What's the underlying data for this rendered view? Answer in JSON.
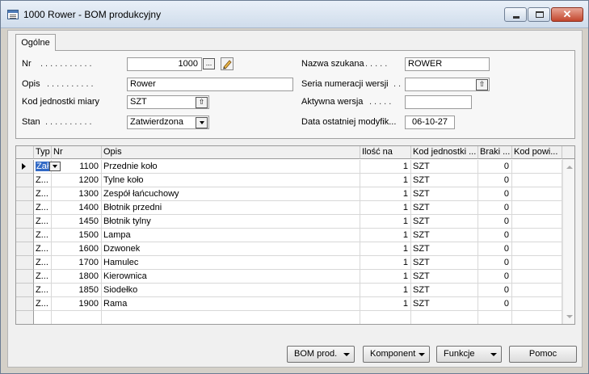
{
  "window": {
    "title": "1000 Rower - BOM produkcyjny"
  },
  "tabs": [
    {
      "label": "Ogólne"
    }
  ],
  "form": {
    "nr_label": "Nr",
    "nr_value": "1000",
    "opis_label": "Opis",
    "opis_value": "Rower",
    "kod_label": "Kod jednostki miary",
    "kod_value": "SZT",
    "stan_label": "Stan",
    "stan_value": "Zatwierdzona",
    "nazwa_label": "Nazwa szukana",
    "nazwa_value": "ROWER",
    "seria_label": "Seria numeracji wersji",
    "seria_value": "",
    "aktywna_label": "Aktywna wersja",
    "aktywna_value": "",
    "data_label": "Data ostatniej modyfik...",
    "data_value": "06-10-27",
    "lookup_glyph": "...",
    "up_glyph": "⇧"
  },
  "grid": {
    "headers": [
      "Typ",
      "Nr",
      "Opis",
      "Ilość na",
      "Kod jednostki ...",
      "Braki ...",
      "Kod powi..."
    ],
    "rows": [
      {
        "typ": "Zał",
        "nr": "1100",
        "opis": "Przednie koło",
        "ilosc": "1",
        "kod": "SZT",
        "braki": "0"
      },
      {
        "typ": "Z...",
        "nr": "1200",
        "opis": "Tylne koło",
        "ilosc": "1",
        "kod": "SZT",
        "braki": "0"
      },
      {
        "typ": "Z...",
        "nr": "1300",
        "opis": "Zespół łańcuchowy",
        "ilosc": "1",
        "kod": "SZT",
        "braki": "0"
      },
      {
        "typ": "Z...",
        "nr": "1400",
        "opis": "Błotnik przedni",
        "ilosc": "1",
        "kod": "SZT",
        "braki": "0"
      },
      {
        "typ": "Z...",
        "nr": "1450",
        "opis": "Błotnik tylny",
        "ilosc": "1",
        "kod": "SZT",
        "braki": "0"
      },
      {
        "typ": "Z...",
        "nr": "1500",
        "opis": "Lampa",
        "ilosc": "1",
        "kod": "SZT",
        "braki": "0"
      },
      {
        "typ": "Z...",
        "nr": "1600",
        "opis": "Dzwonek",
        "ilosc": "1",
        "kod": "SZT",
        "braki": "0"
      },
      {
        "typ": "Z...",
        "nr": "1700",
        "opis": "Hamulec",
        "ilosc": "1",
        "kod": "SZT",
        "braki": "0"
      },
      {
        "typ": "Z...",
        "nr": "1800",
        "opis": "Kierownica",
        "ilosc": "1",
        "kod": "SZT",
        "braki": "0"
      },
      {
        "typ": "Z...",
        "nr": "1850",
        "opis": "Siodełko",
        "ilosc": "1",
        "kod": "SZT",
        "braki": "0"
      },
      {
        "typ": "Z...",
        "nr": "1900",
        "opis": "Rama",
        "ilosc": "1",
        "kod": "SZT",
        "braki": "0"
      }
    ]
  },
  "buttons": {
    "bom": "BOM prod.",
    "komponent": "Komponent",
    "funkcje": "Funkcje",
    "pomoc": "Pomoc"
  }
}
